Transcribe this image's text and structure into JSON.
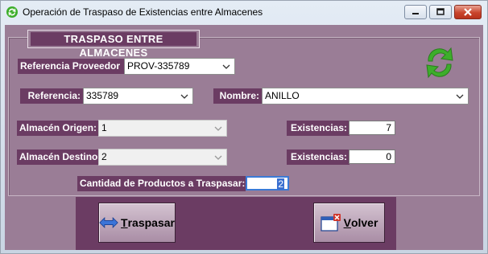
{
  "window": {
    "title": "Operación de Traspaso de Existencias entre Almacenes",
    "icons": {
      "app": "refresh-app-icon",
      "minimize": "minimize-icon",
      "maximize": "maximize-icon",
      "close": "close-icon"
    }
  },
  "form": {
    "section_title": "TRASPASO ENTRE ALMACENES",
    "referencia_proveedor": {
      "label": "Referencia Proveedor",
      "value": "PROV-335789"
    },
    "referencia": {
      "label": "Referencia:",
      "value": "335789"
    },
    "nombre": {
      "label": "Nombre:",
      "value": "ANILLO"
    },
    "almacen_origen": {
      "label": "Almacén Origen:",
      "value": "1",
      "existencias_label": "Existencias:",
      "existencias": "7"
    },
    "almacen_destino": {
      "label": "Almacén Destino:",
      "value": "2",
      "existencias_label": "Existencias:",
      "existencias": "0"
    },
    "cantidad": {
      "label": "Cantidad de Productos a Traspasar:",
      "value": "2"
    }
  },
  "buttons": {
    "traspasar": {
      "mnemonic": "T",
      "rest": "raspasar",
      "icon": "transfer-arrows-icon"
    },
    "volver": {
      "mnemonic": "V",
      "rest": "olver",
      "icon": "close-window-icon"
    }
  },
  "colors": {
    "panel": "#9a7d96",
    "label_bg": "#6b3c63",
    "sync_green": "#3dae2b"
  }
}
